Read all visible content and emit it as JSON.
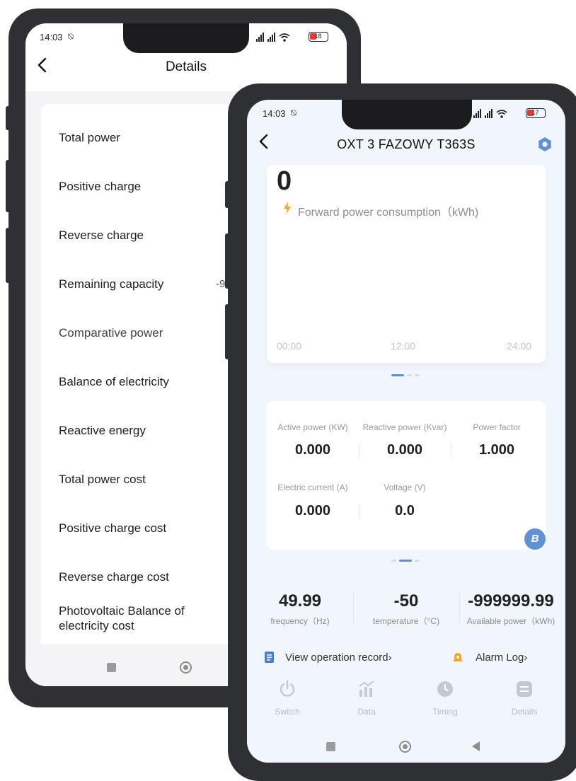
{
  "details_screen": {
    "status_time": "14:03",
    "battery": "18",
    "title": "Details",
    "items": [
      {
        "label": "Total power"
      },
      {
        "label": "Positive charge"
      },
      {
        "label": "Reverse charge"
      },
      {
        "label": "Remaining capacity",
        "value": "-9"
      },
      {
        "label": "Comparative power"
      },
      {
        "label": "Balance of electricity"
      },
      {
        "label": "Reactive energy"
      },
      {
        "label": "Total power cost"
      },
      {
        "label": "Positive charge cost"
      },
      {
        "label": "Reverse charge cost"
      },
      {
        "label": "Photovoltaic Balance of electricity cost"
      }
    ]
  },
  "device_screen": {
    "status_time": "14:03",
    "battery": "17",
    "title": "OXT 3 FAZOWY T363S",
    "consumption": {
      "value": "0",
      "label": "Forward power consumption（kWh)",
      "ticks": [
        "00:00",
        "12:00",
        "24:00"
      ]
    },
    "metrics": [
      {
        "label": "Active power (KW)",
        "value": "0.000"
      },
      {
        "label": "Reactive power (Kvar)",
        "value": "0.000"
      },
      {
        "label": "Power factor",
        "value": "1.000"
      },
      {
        "label": "Electric current (A)",
        "value": "0.000"
      },
      {
        "label": "Voltage (V)",
        "value": "0.0"
      }
    ],
    "badge": "B",
    "stats": [
      {
        "value": "49.99",
        "label": "frequency（Hz)"
      },
      {
        "value": "-50",
        "label": "temperature（°C)"
      },
      {
        "value": "-999999.99",
        "label": "Available power（kWh)"
      }
    ],
    "links": {
      "operation": "View operation record›",
      "alarm": "Alarm Log›"
    },
    "tabs": [
      {
        "label": "Switch",
        "icon": "power-icon"
      },
      {
        "label": "Data",
        "icon": "chart-icon"
      },
      {
        "label": "Timing",
        "icon": "clock-icon"
      },
      {
        "label": "Details",
        "icon": "list-icon"
      }
    ],
    "colors": {
      "accent": "#4a7fd0",
      "lightning": "#f5a623",
      "alarm": "#f5a623",
      "tab_icon": "#c3c9d3"
    }
  }
}
